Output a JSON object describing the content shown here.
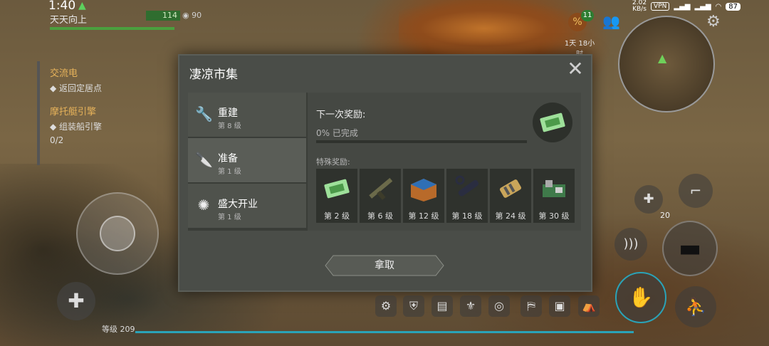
{
  "status": {
    "time": "1:40",
    "net_speed": "2.02\nKB/s",
    "vpn": "VPN",
    "battery": "87"
  },
  "player": {
    "name": "天天向上",
    "hp": "114",
    "food": "90"
  },
  "quests": [
    {
      "title": "交流电",
      "item": "返回定居点"
    },
    {
      "title": "摩托艇引擎",
      "item": "组装船引擎",
      "progress": "0/2"
    }
  ],
  "top_right": {
    "badge": "11",
    "timer": "1天 18小时"
  },
  "dialog": {
    "title": "凄凉市集",
    "tabs": [
      {
        "name": "重建",
        "level": "第 8 级",
        "icon": "wrench-icon"
      },
      {
        "name": "准备",
        "level": "第 1 级",
        "icon": "knife-icon"
      },
      {
        "name": "盛大开业",
        "level": "第 1 级",
        "icon": "firework-icon"
      }
    ],
    "next_reward_label": "下一次奖励:",
    "progress_text": "0% 已完成",
    "progress_value": 0,
    "special_label": "特殊奖励:",
    "rewards": [
      {
        "level": "第 2 级",
        "icon": "ticket-icon"
      },
      {
        "level": "第 6 级",
        "icon": "rifle-icon"
      },
      {
        "level": "第 12 级",
        "icon": "crate-icon"
      },
      {
        "level": "第 18 级",
        "icon": "silencer-icon"
      },
      {
        "level": "第 24 级",
        "icon": "engine-part-icon"
      },
      {
        "level": "第 30 级",
        "icon": "circuit-icon"
      }
    ],
    "take_button": "拿取"
  },
  "hud": {
    "level_text": "等级 209",
    "ammo": "20"
  }
}
